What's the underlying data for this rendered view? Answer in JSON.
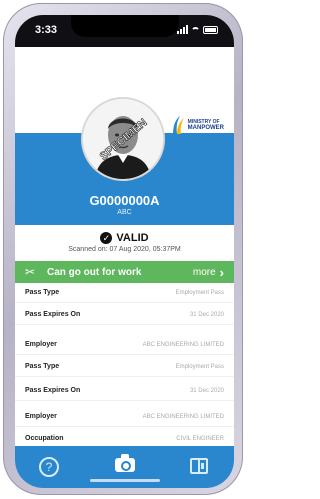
{
  "status_bar": {
    "time": "3:33"
  },
  "logo": {
    "line1": "MINISTRY OF",
    "line2": "MANPOWER"
  },
  "photo": {
    "watermark": "SPECIMEN"
  },
  "pass": {
    "number": "G0000000A",
    "company_short": "ABC"
  },
  "status": {
    "label": "VALID",
    "scanned": "Scanned on: 07 Aug 2020, 05:37PM"
  },
  "banner": {
    "text": "Can go out for work",
    "more": "more"
  },
  "details": [
    {
      "key": "Pass Type",
      "value": "Employment Pass"
    },
    {
      "key": "Pass Expires On",
      "value": "31 Dec 2020"
    },
    {
      "key": "Employer",
      "value": "ABC ENGINEERING LIMITED"
    },
    {
      "key": "Pass Type",
      "value": "Employment Pass"
    },
    {
      "key": "Pass Expires On",
      "value": "31 Dec 2020"
    },
    {
      "key": "Employer",
      "value": "ABC ENGINEERING LIMITED"
    },
    {
      "key": "Occupation",
      "value": "CIVIL ENGINEER"
    }
  ],
  "colors": {
    "brand_blue": "#2a86cd",
    "valid_green": "#5fb75d"
  },
  "icons": {
    "help": "help-icon",
    "camera": "camera-icon",
    "book": "book-icon",
    "work": "tools-icon",
    "chevron": "chevron-right-icon"
  }
}
